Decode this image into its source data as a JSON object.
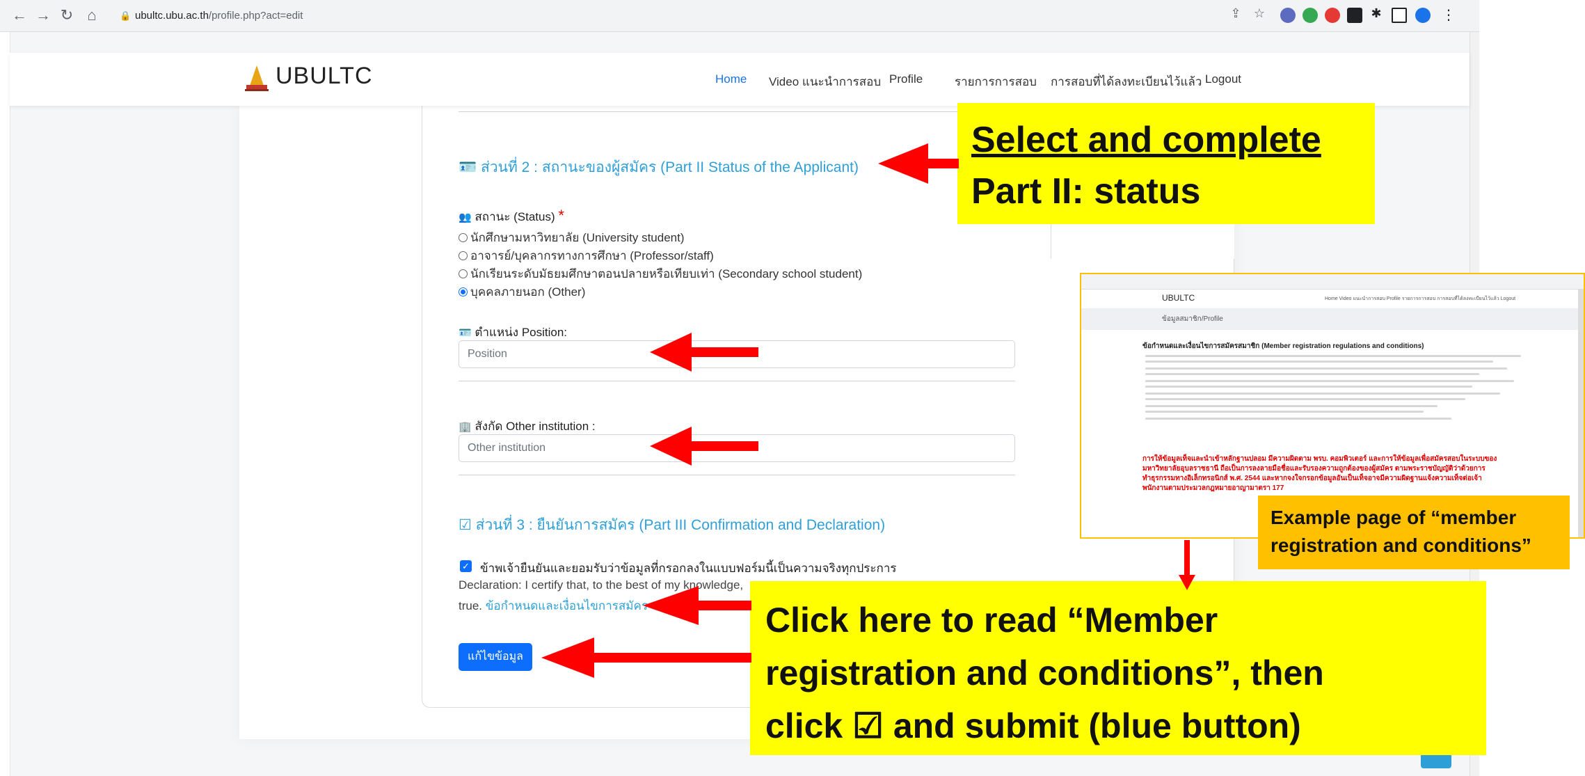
{
  "browser": {
    "url_domain": "ubultc.ubu.ac.th",
    "url_path": "/profile.php?act=edit"
  },
  "header": {
    "logo_text": "UBULTC",
    "nav": [
      "Home",
      "Video แนะนำการสอบ",
      "Profile",
      "รายการการสอบ",
      "การสอบที่ได้ลงทะเบียนไว้แล้ว",
      "Logout"
    ],
    "active_nav": "Home"
  },
  "form": {
    "part2_title": "ส่วนที่ 2 : สถานะของผู้สมัคร (Part II Status of the Applicant)",
    "status_label": "สถานะ (Status)",
    "required_mark": "*",
    "status_options": [
      "นักศึกษามหาวิทยาลัย (University student)",
      "อาจารย์/บุคลากรทางการศึกษา (Professor/staff)",
      "นักเรียนระดับมัธยมศึกษาตอนปลายหรือเทียบเท่า (Secondary school student)",
      "บุคคลภายนอก (Other)"
    ],
    "status_selected_index": 3,
    "position_label": "ตำแหน่ง Position:",
    "position_placeholder": "Position",
    "institution_label": "สังกัด Other institution :",
    "institution_placeholder": "Other institution",
    "part3_title": "ส่วนที่ 3 : ยืนยันการสมัคร (Part III Confirmation and Declaration)",
    "confirm_text": "ข้าพเจ้ายืนยันและยอมรับว่าข้อมูลที่กรอกลงในแบบฟอร์มนี้เป็นความจริงทุกประการ",
    "confirm_checked": true,
    "declaration_text": "Declaration: I certify that, to the best of my knowledge,",
    "declaration_end": "true.",
    "terms_link": "ข้อกำหนดและเงื่อนไขการสมัคร",
    "submit_label": "แก้ไขข้อมูล"
  },
  "callouts": {
    "top_line1": "Select and complete",
    "top_line2": "Part II: status",
    "bottom_line1": "Click here to read “Member",
    "bottom_line2": "registration and conditions”, then",
    "bottom_line3": "click ☑ and submit (blue button)",
    "orange_line1": "Example page of “member",
    "orange_line2": "registration and conditions”"
  },
  "thumbnail": {
    "logo": "UBULTC",
    "nav": "Home   Video แนะนำการสอบ   Profile   รายการการสอบ   การสอบที่ได้ลงทะเบียนไว้แล้ว   Logout",
    "crumb": "ข้อมูลสมาชิก/Profile",
    "heading": "ข้อกำหนดและเงื่อนไขการสมัครสมาชิก (Member registration regulations and conditions)",
    "red_1": "การให้ข้อมูลเท็จและนำเข้าหลักฐานปลอม มีความผิดตาม พรบ. คอมพิวเตอร์ และการให้ข้อมูลเพื่อสมัครสอบในระบบของ",
    "red_2": "มหาวิทยาลัยอุบลราชธานี ถือเป็นการลงลายมือชื่อและรับรองความถูกต้องของผู้สมัคร ตามพระราชบัญญัติว่าด้วยการ",
    "red_3": "ทำธุรกรรมทางอิเล็กทรอนิกส์ พ.ศ. 2544 และหากจงใจกรอกข้อมูลอันเป็นเท็จอาจมีความผิดฐานแจ้งความเท็จต่อเจ้า",
    "red_4": "พนักงานตามประมวลกฎหมายอาญามาตรา 177"
  },
  "colors": {
    "accent": "#2f9fd8",
    "primary_button": "#0d6efd",
    "callout_yellow": "#ffff00",
    "callout_orange": "#ffc000",
    "arrow_red": "#ff0000"
  }
}
